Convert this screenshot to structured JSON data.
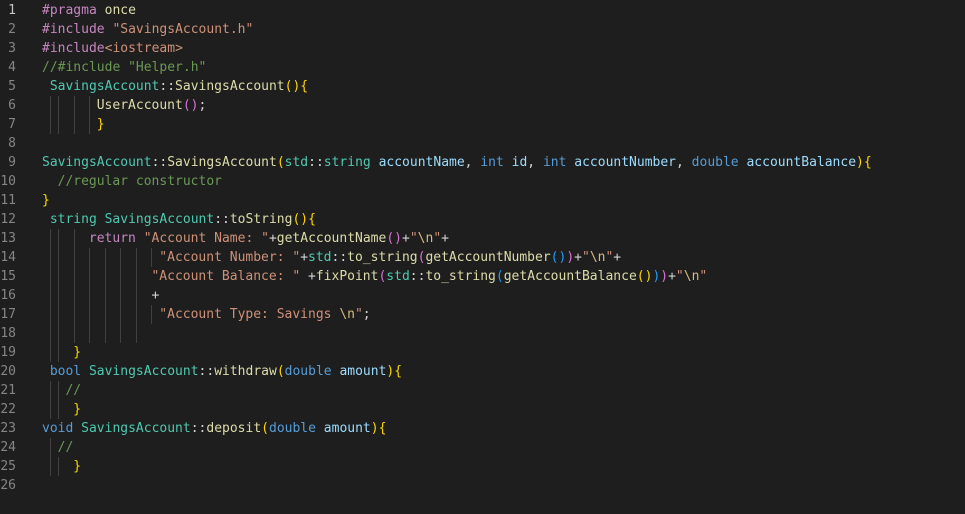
{
  "editor": {
    "lines": [
      {
        "n": "1",
        "indent": 0,
        "tokens": [
          {
            "c": "pp",
            "t": "#pragma"
          },
          {
            "c": "txt",
            "t": " "
          },
          {
            "c": "fn",
            "t": "once"
          }
        ]
      },
      {
        "n": "2",
        "indent": 0,
        "tokens": [
          {
            "c": "pp",
            "t": "#include"
          },
          {
            "c": "txt",
            "t": " "
          },
          {
            "c": "str",
            "t": "\"SavingsAccount.h\""
          }
        ]
      },
      {
        "n": "3",
        "indent": 0,
        "tokens": [
          {
            "c": "pp",
            "t": "#include"
          },
          {
            "c": "str",
            "t": "<iostream>"
          }
        ]
      },
      {
        "n": "4",
        "indent": 0,
        "tokens": [
          {
            "c": "cmt",
            "t": "//#include \"Helper.h\""
          }
        ]
      },
      {
        "n": "5",
        "indent": 1,
        "tokens": [
          {
            "c": "cls",
            "t": "SavingsAccount"
          },
          {
            "c": "txt",
            "t": "::"
          },
          {
            "c": "fn",
            "t": "SavingsAccount"
          },
          {
            "c": "br1",
            "t": "()"
          },
          {
            "c": "br1",
            "t": "{"
          }
        ]
      },
      {
        "n": "6",
        "indent": 7,
        "tokens": [
          {
            "c": "fn",
            "t": "UserAccount"
          },
          {
            "c": "br2",
            "t": "()"
          },
          {
            "c": "txt",
            "t": ";"
          }
        ]
      },
      {
        "n": "7",
        "indent": 7,
        "tokens": [
          {
            "c": "br1",
            "t": "}"
          }
        ]
      },
      {
        "n": "8",
        "indent": 0,
        "tokens": []
      },
      {
        "n": "9",
        "indent": 0,
        "tokens": [
          {
            "c": "cls",
            "t": "SavingsAccount"
          },
          {
            "c": "txt",
            "t": "::"
          },
          {
            "c": "fn",
            "t": "SavingsAccount"
          },
          {
            "c": "br1",
            "t": "("
          },
          {
            "c": "cls",
            "t": "std"
          },
          {
            "c": "txt",
            "t": "::"
          },
          {
            "c": "cls",
            "t": "string"
          },
          {
            "c": "txt",
            "t": " "
          },
          {
            "c": "var",
            "t": "accountName"
          },
          {
            "c": "txt",
            "t": ", "
          },
          {
            "c": "kw",
            "t": "int"
          },
          {
            "c": "txt",
            "t": " "
          },
          {
            "c": "var",
            "t": "id"
          },
          {
            "c": "txt",
            "t": ", "
          },
          {
            "c": "kw",
            "t": "int"
          },
          {
            "c": "txt",
            "t": " "
          },
          {
            "c": "var",
            "t": "accountNumber"
          },
          {
            "c": "txt",
            "t": ", "
          },
          {
            "c": "kw",
            "t": "double"
          },
          {
            "c": "txt",
            "t": " "
          },
          {
            "c": "var",
            "t": "accountBalance"
          },
          {
            "c": "br1",
            "t": ")"
          },
          {
            "c": "br1",
            "t": "{"
          }
        ]
      },
      {
        "n": "10",
        "indent": 2,
        "tokens": [
          {
            "c": "cmt",
            "t": "//regular constructor"
          }
        ]
      },
      {
        "n": "11",
        "indent": 0,
        "tokens": [
          {
            "c": "br1",
            "t": "}"
          }
        ]
      },
      {
        "n": "12",
        "indent": 1,
        "tokens": [
          {
            "c": "cls",
            "t": "string"
          },
          {
            "c": "txt",
            "t": " "
          },
          {
            "c": "cls",
            "t": "SavingsAccount"
          },
          {
            "c": "txt",
            "t": "::"
          },
          {
            "c": "fn",
            "t": "toString"
          },
          {
            "c": "br1",
            "t": "()"
          },
          {
            "c": "br1",
            "t": "{"
          }
        ]
      },
      {
        "n": "13",
        "indent": 6,
        "tokens": [
          {
            "c": "ctl",
            "t": "return"
          },
          {
            "c": "txt",
            "t": " "
          },
          {
            "c": "str",
            "t": "\"Account Name: \""
          },
          {
            "c": "txt",
            "t": "+"
          },
          {
            "c": "fn",
            "t": "getAccountName"
          },
          {
            "c": "br2",
            "t": "()"
          },
          {
            "c": "txt",
            "t": "+"
          },
          {
            "c": "str",
            "t": "\""
          },
          {
            "c": "esc",
            "t": "\\n"
          },
          {
            "c": "str",
            "t": "\""
          },
          {
            "c": "txt",
            "t": "+"
          }
        ]
      },
      {
        "n": "14",
        "indent": 15,
        "tokens": [
          {
            "c": "str",
            "t": "\"Account Number: \""
          },
          {
            "c": "txt",
            "t": "+"
          },
          {
            "c": "cls",
            "t": "std"
          },
          {
            "c": "txt",
            "t": "::"
          },
          {
            "c": "fn",
            "t": "to_string"
          },
          {
            "c": "br2",
            "t": "("
          },
          {
            "c": "fn",
            "t": "getAccountNumber"
          },
          {
            "c": "br3",
            "t": "()"
          },
          {
            "c": "br2",
            "t": ")"
          },
          {
            "c": "txt",
            "t": "+"
          },
          {
            "c": "str",
            "t": "\""
          },
          {
            "c": "esc",
            "t": "\\n"
          },
          {
            "c": "str",
            "t": "\""
          },
          {
            "c": "txt",
            "t": "+"
          }
        ]
      },
      {
        "n": "15",
        "indent": 14,
        "tokens": [
          {
            "c": "str",
            "t": "\"Account Balance: \""
          },
          {
            "c": "txt",
            "t": " +"
          },
          {
            "c": "fn",
            "t": "fixPoint"
          },
          {
            "c": "br2",
            "t": "("
          },
          {
            "c": "cls",
            "t": "std"
          },
          {
            "c": "txt",
            "t": "::"
          },
          {
            "c": "fn",
            "t": "to_string"
          },
          {
            "c": "br3",
            "t": "("
          },
          {
            "c": "fn",
            "t": "getAccountBalance"
          },
          {
            "c": "br1",
            "t": "()"
          },
          {
            "c": "br3",
            "t": ")"
          },
          {
            "c": "br2",
            "t": ")"
          },
          {
            "c": "txt",
            "t": "+"
          },
          {
            "c": "str",
            "t": "\""
          },
          {
            "c": "esc",
            "t": "\\n"
          },
          {
            "c": "str",
            "t": "\""
          }
        ]
      },
      {
        "n": "16",
        "indent": 14,
        "tokens": [
          {
            "c": "txt",
            "t": "+"
          }
        ]
      },
      {
        "n": "17",
        "indent": 15,
        "tokens": [
          {
            "c": "str",
            "t": "\"Account Type: Savings "
          },
          {
            "c": "esc",
            "t": "\\n"
          },
          {
            "c": "str",
            "t": "\""
          },
          {
            "c": "txt",
            "t": ";"
          }
        ]
      },
      {
        "n": "18",
        "indent": 0,
        "tokens": []
      },
      {
        "n": "19",
        "indent": 4,
        "tokens": [
          {
            "c": "br1",
            "t": "}"
          }
        ]
      },
      {
        "n": "20",
        "indent": 1,
        "tokens": [
          {
            "c": "kw",
            "t": "bool"
          },
          {
            "c": "txt",
            "t": " "
          },
          {
            "c": "cls",
            "t": "SavingsAccount"
          },
          {
            "c": "txt",
            "t": "::"
          },
          {
            "c": "fn",
            "t": "withdraw"
          },
          {
            "c": "br1",
            "t": "("
          },
          {
            "c": "kw",
            "t": "double"
          },
          {
            "c": "txt",
            "t": " "
          },
          {
            "c": "var",
            "t": "amount"
          },
          {
            "c": "br1",
            "t": ")"
          },
          {
            "c": "br1",
            "t": "{"
          }
        ]
      },
      {
        "n": "21",
        "indent": 3,
        "tokens": [
          {
            "c": "cmt",
            "t": "//"
          }
        ]
      },
      {
        "n": "22",
        "indent": 4,
        "tokens": [
          {
            "c": "br1",
            "t": "}"
          }
        ]
      },
      {
        "n": "23",
        "indent": 0,
        "tokens": [
          {
            "c": "kw",
            "t": "void"
          },
          {
            "c": "txt",
            "t": " "
          },
          {
            "c": "cls",
            "t": "SavingsAccount"
          },
          {
            "c": "txt",
            "t": "::"
          },
          {
            "c": "fn",
            "t": "deposit"
          },
          {
            "c": "br1",
            "t": "("
          },
          {
            "c": "kw",
            "t": "double"
          },
          {
            "c": "txt",
            "t": " "
          },
          {
            "c": "var",
            "t": "amount"
          },
          {
            "c": "br1",
            "t": ")"
          },
          {
            "c": "br1",
            "t": "{"
          }
        ]
      },
      {
        "n": "24",
        "indent": 2,
        "tokens": [
          {
            "c": "cmt",
            "t": "//"
          }
        ]
      },
      {
        "n": "25",
        "indent": 4,
        "tokens": [
          {
            "c": "br1",
            "t": "}"
          }
        ]
      },
      {
        "n": "26",
        "indent": 0,
        "tokens": []
      }
    ]
  },
  "colors": {
    "background": "#1e1e1e",
    "line_number": "#858585",
    "indent_guide": "#404040"
  }
}
